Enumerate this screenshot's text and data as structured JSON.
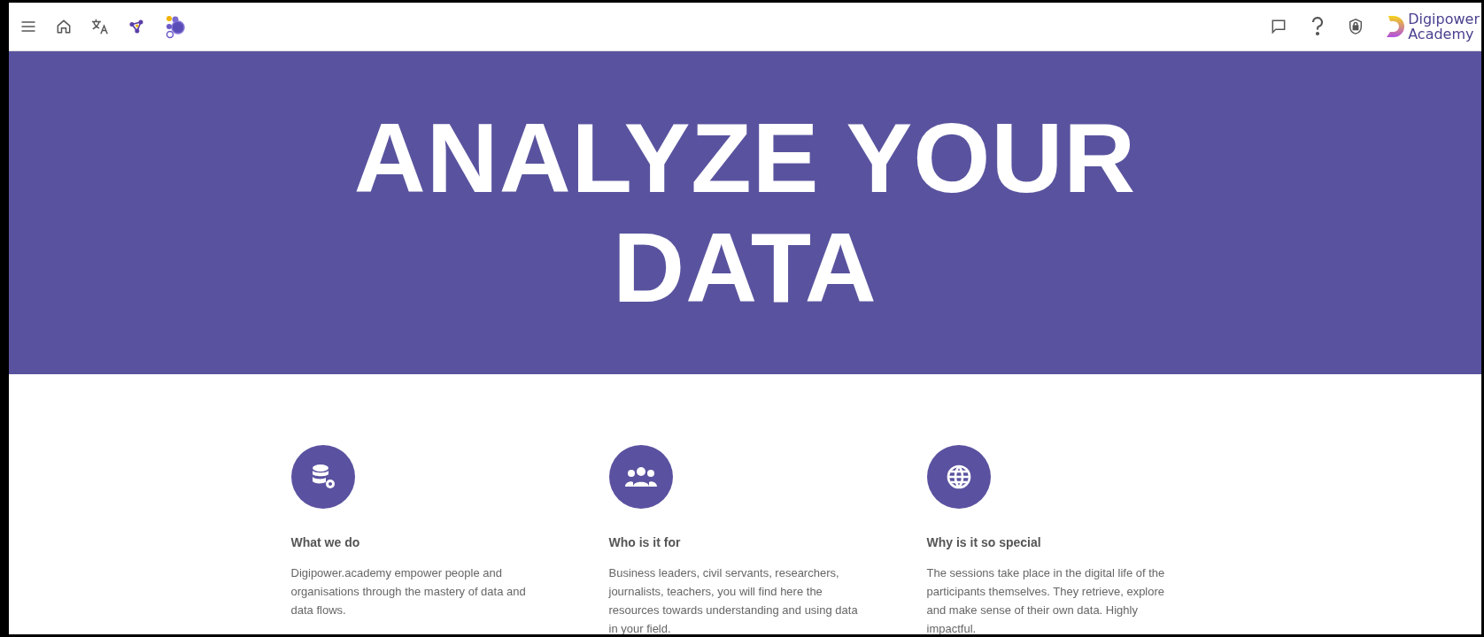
{
  "header": {
    "brand": [
      "Digipower",
      "Academy"
    ]
  },
  "hero": {
    "title": "ANALYZE YOUR DATA"
  },
  "features": [
    {
      "title": "What we do",
      "text": "Digipower.academy empower people and organisations through the mastery of data and data flows."
    },
    {
      "title": "Who is it for",
      "text": "Business leaders, civil servants, researchers, journalists, teachers, you will find here the resources towards understanding and using data in your field."
    },
    {
      "title": "Why is it so special",
      "text": "The sessions take place in the digital life of the participants themselves. They retrieve, explore and make sense of their own data. Highly impactful."
    }
  ]
}
